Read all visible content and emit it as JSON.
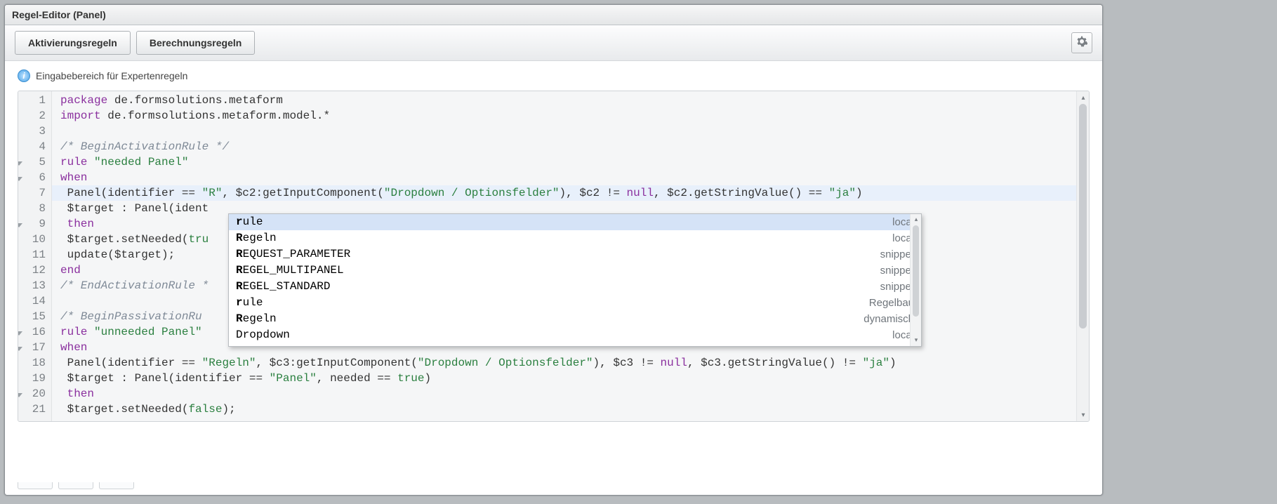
{
  "window": {
    "title": "Regel-Editor (Panel)"
  },
  "toolbar": {
    "tab_activation": "Aktivierungsregeln",
    "tab_calculation": "Berechnungsregeln"
  },
  "info": {
    "text": "Eingabebereich für Expertenregeln"
  },
  "code_lines": [
    {
      "n": 1,
      "fold": false,
      "hl": false,
      "tokens": [
        [
          "kw",
          "package"
        ],
        [
          "var",
          " de.formsolutions.metaform"
        ]
      ]
    },
    {
      "n": 2,
      "fold": false,
      "hl": false,
      "tokens": [
        [
          "kw",
          "import"
        ],
        [
          "var",
          " de.formsolutions.metaform.model.*"
        ]
      ]
    },
    {
      "n": 3,
      "fold": false,
      "hl": false,
      "tokens": []
    },
    {
      "n": 4,
      "fold": false,
      "hl": false,
      "tokens": [
        [
          "cmt",
          "/* BeginActivationRule */"
        ]
      ]
    },
    {
      "n": 5,
      "fold": true,
      "hl": false,
      "tokens": [
        [
          "kw",
          "rule "
        ],
        [
          "str",
          "\"needed Panel\""
        ]
      ]
    },
    {
      "n": 6,
      "fold": true,
      "hl": false,
      "tokens": [
        [
          "kw",
          "when"
        ]
      ]
    },
    {
      "n": 7,
      "fold": false,
      "hl": true,
      "tokens": [
        [
          "var",
          " Panel(identifier == "
        ],
        [
          "str",
          "\"R\""
        ],
        [
          "var",
          ", $c2:getInputComponent("
        ],
        [
          "str",
          "\"Dropdown / Optionsfelder\""
        ],
        [
          "var",
          "), $c2 != "
        ],
        [
          "kw",
          "null"
        ],
        [
          "var",
          ", $c2.getStringValue() == "
        ],
        [
          "str",
          "\"ja\""
        ],
        [
          "var",
          ")"
        ]
      ]
    },
    {
      "n": 8,
      "fold": false,
      "hl": false,
      "tokens": [
        [
          "var",
          " $target : Panel(ident"
        ]
      ]
    },
    {
      "n": 9,
      "fold": true,
      "hl": false,
      "tokens": [
        [
          "kw",
          " then"
        ]
      ]
    },
    {
      "n": 10,
      "fold": false,
      "hl": false,
      "tokens": [
        [
          "var",
          " $target.setNeeded("
        ],
        [
          "bool",
          "tru"
        ]
      ]
    },
    {
      "n": 11,
      "fold": false,
      "hl": false,
      "tokens": [
        [
          "var",
          " update($target);"
        ]
      ]
    },
    {
      "n": 12,
      "fold": false,
      "hl": false,
      "tokens": [
        [
          "kw",
          "end"
        ]
      ]
    },
    {
      "n": 13,
      "fold": false,
      "hl": false,
      "tokens": [
        [
          "cmt",
          "/* EndActivationRule *"
        ]
      ]
    },
    {
      "n": 14,
      "fold": false,
      "hl": false,
      "tokens": []
    },
    {
      "n": 15,
      "fold": false,
      "hl": false,
      "tokens": [
        [
          "cmt",
          "/* BeginPassivationRu"
        ]
      ]
    },
    {
      "n": 16,
      "fold": true,
      "hl": false,
      "tokens": [
        [
          "kw",
          "rule "
        ],
        [
          "str",
          "\"unneeded Panel\""
        ]
      ]
    },
    {
      "n": 17,
      "fold": true,
      "hl": false,
      "tokens": [
        [
          "kw",
          "when"
        ]
      ]
    },
    {
      "n": 18,
      "fold": false,
      "hl": false,
      "tokens": [
        [
          "var",
          " Panel(identifier == "
        ],
        [
          "str",
          "\"Regeln\""
        ],
        [
          "var",
          ", $c3:getInputComponent("
        ],
        [
          "str",
          "\"Dropdown / Optionsfelder\""
        ],
        [
          "var",
          "), $c3 != "
        ],
        [
          "kw",
          "null"
        ],
        [
          "var",
          ", $c3.getStringValue() != "
        ],
        [
          "str",
          "\"ja\""
        ],
        [
          "var",
          ")"
        ]
      ]
    },
    {
      "n": 19,
      "fold": false,
      "hl": false,
      "tokens": [
        [
          "var",
          " $target : Panel(identifier == "
        ],
        [
          "str",
          "\"Panel\""
        ],
        [
          "var",
          ", needed == "
        ],
        [
          "bool",
          "true"
        ],
        [
          "var",
          ")"
        ]
      ]
    },
    {
      "n": 20,
      "fold": true,
      "hl": false,
      "tokens": [
        [
          "kw",
          " then"
        ]
      ]
    },
    {
      "n": 21,
      "fold": false,
      "hl": false,
      "tokens": [
        [
          "var",
          " $target.setNeeded("
        ],
        [
          "bool",
          "false"
        ],
        [
          "var",
          ");"
        ]
      ]
    }
  ],
  "autocomplete": {
    "prefix": "r",
    "items": [
      {
        "label": "rule",
        "kind": "local",
        "selected": true
      },
      {
        "label": "Regeln",
        "kind": "local",
        "selected": false
      },
      {
        "label": "REQUEST_PARAMETER",
        "kind": "snippet",
        "selected": false
      },
      {
        "label": "REGEL_MULTIPANEL",
        "kind": "snippet",
        "selected": false
      },
      {
        "label": "REGEL_STANDARD",
        "kind": "snippet",
        "selected": false
      },
      {
        "label": "rule",
        "kind": "Regelbau",
        "selected": false
      },
      {
        "label": "Regeln",
        "kind": "dynamisch",
        "selected": false
      },
      {
        "label": "Dropdown",
        "kind": "local",
        "selected": false
      }
    ]
  }
}
